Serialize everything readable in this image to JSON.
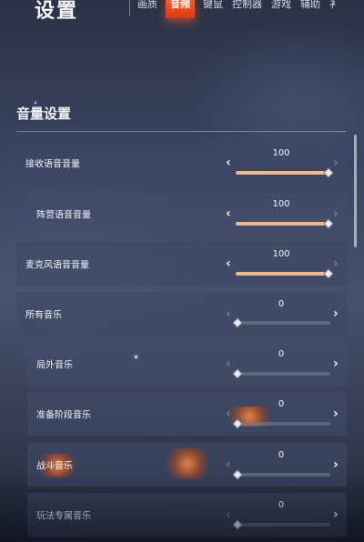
{
  "header": {
    "title": "设置",
    "tabs": [
      {
        "label": "画质",
        "active": false
      },
      {
        "label": "音频",
        "active": true
      },
      {
        "label": "键鼠",
        "active": false
      },
      {
        "label": "控制器",
        "active": false
      },
      {
        "label": "游戏",
        "active": false
      },
      {
        "label": "辅助",
        "active": false
      },
      {
        "label": "衤",
        "active": false
      }
    ]
  },
  "section": {
    "title": "音量设置"
  },
  "settings": [
    {
      "label": "接收语音音量",
      "value": "100",
      "level": 1.0
    },
    {
      "label": "阵营语音音量",
      "value": "100",
      "level": 1.0
    },
    {
      "label": "麦克风语音音量",
      "value": "100",
      "level": 1.0
    },
    {
      "label": "所有音乐",
      "value": "0",
      "level": 0.0
    },
    {
      "label": "局外音乐",
      "value": "0",
      "level": 0.0
    },
    {
      "label": "准备阶段音乐",
      "value": "0",
      "level": 0.0
    },
    {
      "label": "战斗音乐",
      "value": "0",
      "level": 0.0
    },
    {
      "label": "玩法专属音乐",
      "value": "0",
      "level": 0.0
    }
  ],
  "colors": {
    "accent_tab": "#ff5a2a",
    "slider_fill": "#f0b98a"
  },
  "icons": {
    "decrease": "chevron-left-icon",
    "increase": "chevron-right-icon",
    "knob": "diamond-knob-icon"
  }
}
